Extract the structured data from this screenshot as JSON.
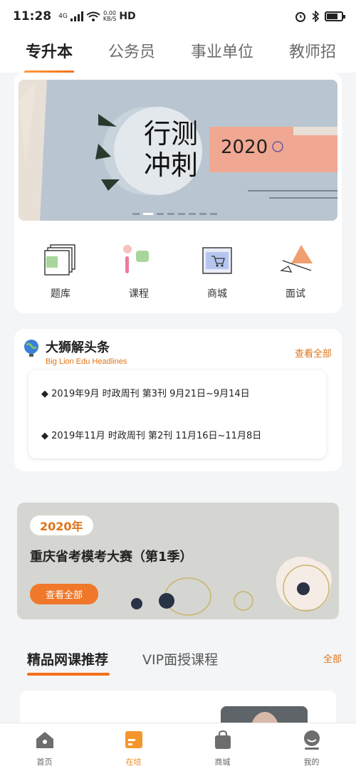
{
  "status_bar": {
    "time": "11:28",
    "network": "4G",
    "speed_value": "0.00",
    "speed_unit": "KB/S",
    "hd": "HD"
  },
  "top_tabs": [
    {
      "label": "专升本",
      "active": true
    },
    {
      "label": "公务员",
      "active": false
    },
    {
      "label": "事业单位",
      "active": false
    },
    {
      "label": "教师招",
      "active": false
    }
  ],
  "banner": {
    "title_line1": "行测",
    "title_line2": "冲刺",
    "year": "2020",
    "slide_count": 8,
    "active_slide": 2
  },
  "quick_icons": [
    {
      "label": "题库",
      "icon": "question-bank-icon"
    },
    {
      "label": "课程",
      "icon": "course-icon"
    },
    {
      "label": "商城",
      "icon": "mall-icon"
    },
    {
      "label": "面试",
      "icon": "interview-icon"
    }
  ],
  "headlines": {
    "title": "大狮解头条",
    "subtitle": "Big Lion Edu Headlines",
    "view_all": "查看全部",
    "items": [
      "◆ 2019年9月 时政周刊 第3刊 9月21日~9月14日",
      "◆ 2019年11月 时政周刊 第2刊 11月16日~11月8日"
    ]
  },
  "contest": {
    "year": "2020年",
    "title": "重庆省考模考大赛（第1季）",
    "button": "查看全部"
  },
  "recommend": {
    "tabs": [
      {
        "label": "精品网课推荐",
        "active": true
      },
      {
        "label": "VIP面授课程",
        "active": false
      }
    ],
    "view_all": "全部"
  },
  "bottom_nav": [
    {
      "label": "首页",
      "icon": "home-icon",
      "active": false
    },
    {
      "label": "在培",
      "icon": "training-icon",
      "active": true
    },
    {
      "label": "商城",
      "icon": "shopping-bag-icon",
      "active": false
    },
    {
      "label": "我的",
      "icon": "profile-icon",
      "active": false
    }
  ],
  "colors": {
    "accent": "#f27018",
    "banner_bg": "#b9c6d1",
    "banner_stripe": "#f0a892",
    "contest_bg": "#d5d6d1"
  }
}
